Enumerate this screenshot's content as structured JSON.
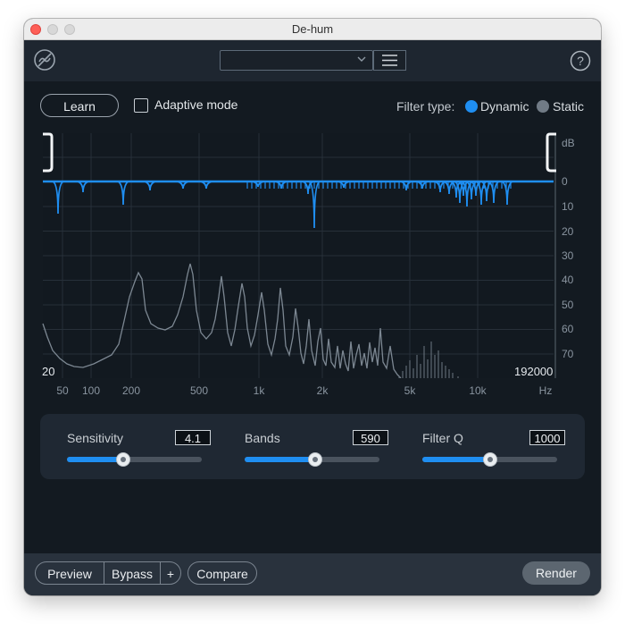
{
  "window": {
    "title": "De-hum"
  },
  "toolbar": {
    "logo_icon": "dehum-logo-icon",
    "preset_value": "",
    "menu_icon": "hamburger-icon",
    "help_icon": "help-icon"
  },
  "controls_top": {
    "learn_label": "Learn",
    "adaptive_label": "Adaptive mode",
    "adaptive_checked": false,
    "filter_type_label": "Filter type:",
    "filter_options": [
      {
        "label": "Dynamic",
        "selected": true
      },
      {
        "label": "Static",
        "selected": false
      }
    ]
  },
  "spectrum": {
    "db_unit": "dB",
    "db_ticks": [
      "0",
      "10",
      "20",
      "30",
      "40",
      "50",
      "60",
      "70"
    ],
    "freq_ticks": [
      "50",
      "100",
      "200",
      "500",
      "1k",
      "2k",
      "5k",
      "10k"
    ],
    "freq_unit": "Hz",
    "range_low": "20",
    "range_high": "192000"
  },
  "parameters": [
    {
      "label": "Sensitivity",
      "value": "4.1",
      "fill_fraction": 0.42
    },
    {
      "label": "Bands",
      "value": "590",
      "fill_fraction": 0.52
    },
    {
      "label": "Filter Q",
      "value": "1000",
      "fill_fraction": 0.5
    }
  ],
  "bottom": {
    "preview_label": "Preview",
    "bypass_label": "Bypass",
    "plus_label": "+",
    "compare_label": "Compare",
    "render_label": "Render"
  },
  "colors": {
    "accent": "#1f8ef1",
    "background": "#131a21",
    "panel": "#1f2833"
  }
}
